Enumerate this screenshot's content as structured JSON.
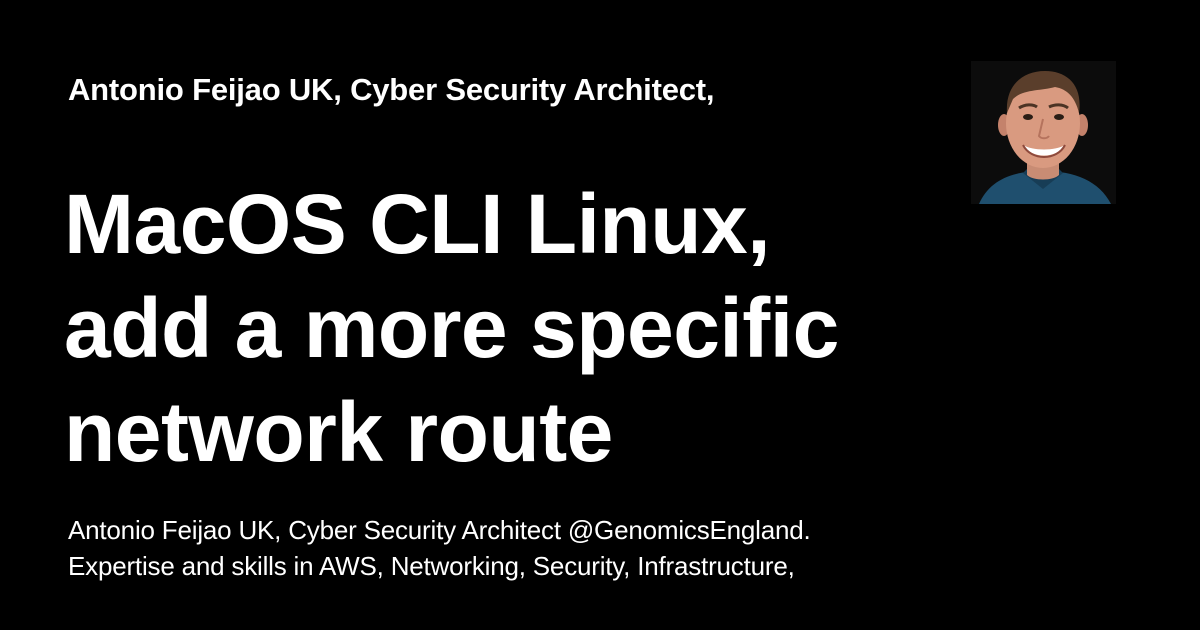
{
  "card": {
    "site_title": "Antonio Feijao UK, Cyber Security Architect,",
    "headline_lines": [
      "MacOS CLI Linux,",
      "add a more specific",
      "network route"
    ],
    "description_lines": [
      "Antonio Feijao UK, Cyber Security Architect @GenomicsEngland.",
      "Expertise and skills in AWS, Networking, Security, Infrastructure,"
    ]
  },
  "colors": {
    "background": "#000000",
    "text": "#ffffff",
    "shirt": "#1f4f6e"
  },
  "avatar": {
    "icon": "author-photo"
  }
}
